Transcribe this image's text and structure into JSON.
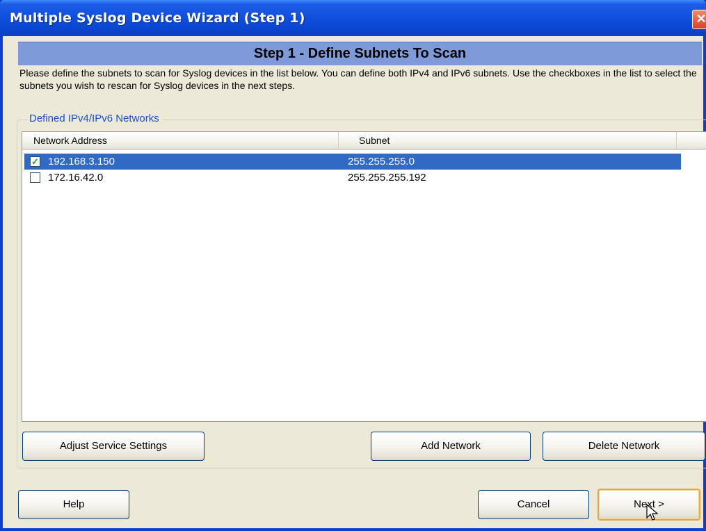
{
  "window": {
    "title": "Multiple Syslog Device Wizard (Step 1)",
    "close_glyph": "✕"
  },
  "banner": {
    "title": "Step 1 - Define Subnets To Scan"
  },
  "description": "Please define the subnets to scan for Syslog devices in the list below.  You can define both IPv4 and IPv6 subnets. Use the checkboxes in the list to select the subnets you wish to rescan for Syslog devices in the next steps.",
  "networks_group": {
    "legend": "Defined IPv4/IPv6 Networks",
    "columns": [
      "Network Address",
      "Subnet"
    ],
    "rows": [
      {
        "address": "192.168.3.150",
        "subnet": "255.255.255.0",
        "checked": true,
        "selected": true
      },
      {
        "address": "172.16.42.0",
        "subnet": "255.255.255.192",
        "checked": false,
        "selected": false
      }
    ]
  },
  "group_buttons": {
    "adjust": "Adjust Service Settings",
    "add": "Add Network",
    "delete": "Delete Network"
  },
  "footer_buttons": {
    "help": "Help",
    "cancel": "Cancel",
    "next": "Next >"
  },
  "colors": {
    "titlebar": "#0a45d0",
    "banner": "#7e9ad8",
    "selection": "#316ac5",
    "legend_text": "#1b50c8",
    "default_button_border": "#e4a64a"
  }
}
